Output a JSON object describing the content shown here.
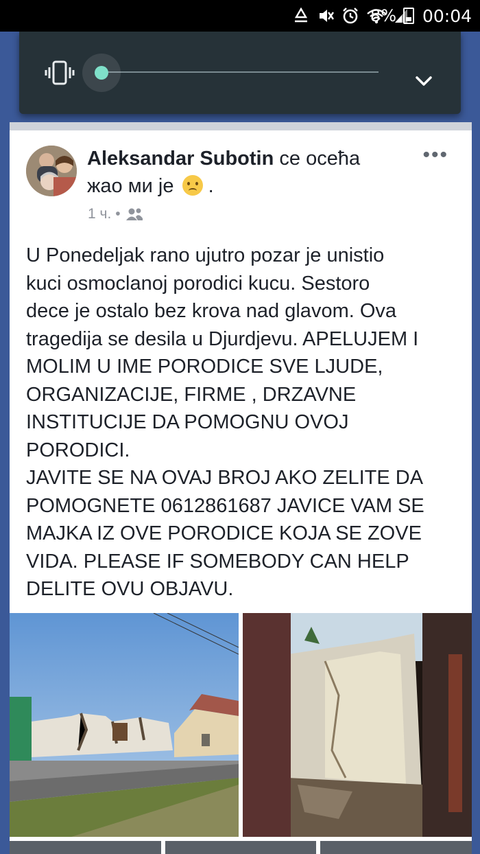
{
  "status_bar": {
    "battery": "8%",
    "time": "00:04",
    "icons": [
      "recycle-notification-icon",
      "mute-vibrate-icon",
      "alarm-icon",
      "wifi-icon",
      "signal-icon",
      "battery-icon"
    ]
  },
  "volume_panel": {
    "mode_icon": "vibrate-icon",
    "level": 0,
    "expand_icon": "chevron-down-icon"
  },
  "post": {
    "author": "Aleksandar Subotin",
    "feeling_prefix": " се осећа",
    "feeling": "жао ми је",
    "feeling_suffix": " .",
    "time": "1 ч.",
    "separator": "•",
    "audience_icon": "friends-icon",
    "body": "U Ponedeljak rano ujutro pozar je unistio\nkuci osmoclanoj porodici kucu. Sestoro\ndece je ostalo bez krova nad glavom. Ova\ntragedija se desila u Djurdjevu. APELUJEM I\nMOLIM U IME PORODICE SVE LJUDE,\nORGANIZACIJE, FIRME , DRZAVNE\nINSTITUCIJE DA POMOGNU OVOJ\nPORODICI.\nJAVITE SE NA OVAJ BROJ AKO ZELITE DA\nPOMOGNETE 0612861687 JAVICE VAM SE\nMAJKA IZ OVE PORODICE KOJA SE ZOVE\nVIDA. PLEASE IF SOMEBODY CAN HELP\nDELITE OVU OBJAVU."
  },
  "colors": {
    "facebook_blue": "#3b5998",
    "volume_panel": "#263238",
    "volume_accent": "#7fe0c9",
    "text": "#1d2129",
    "meta_text": "#90949c"
  }
}
